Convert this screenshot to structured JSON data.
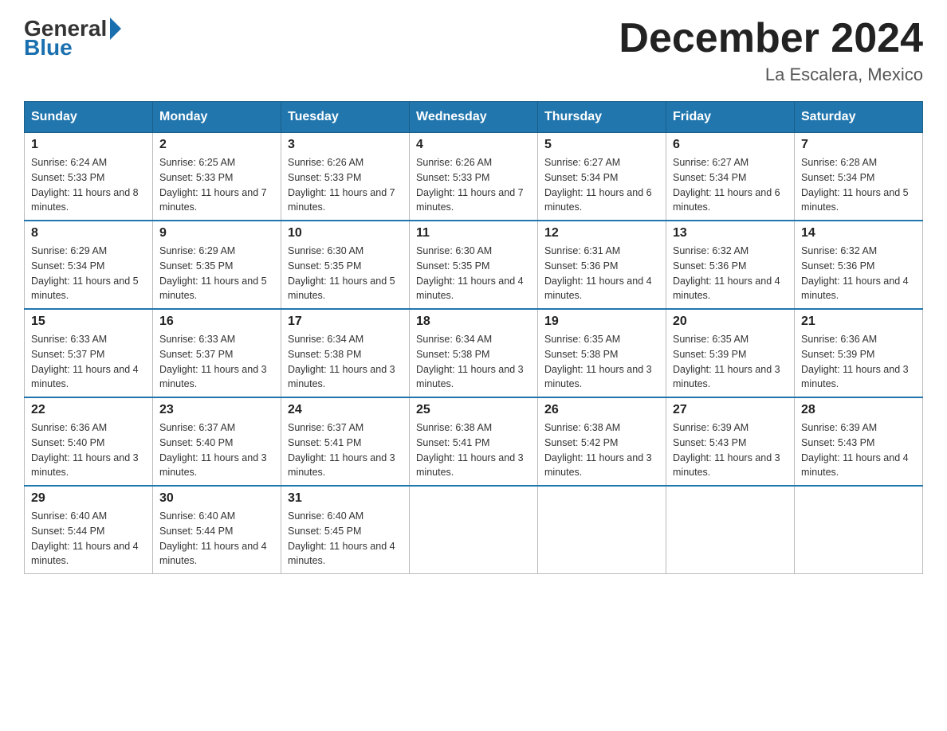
{
  "header": {
    "logo_general": "General",
    "logo_blue": "Blue",
    "month_title": "December 2024",
    "location": "La Escalera, Mexico"
  },
  "days_of_week": [
    "Sunday",
    "Monday",
    "Tuesday",
    "Wednesday",
    "Thursday",
    "Friday",
    "Saturday"
  ],
  "weeks": [
    [
      {
        "num": "1",
        "sunrise": "6:24 AM",
        "sunset": "5:33 PM",
        "daylight": "11 hours and 8 minutes."
      },
      {
        "num": "2",
        "sunrise": "6:25 AM",
        "sunset": "5:33 PM",
        "daylight": "11 hours and 7 minutes."
      },
      {
        "num": "3",
        "sunrise": "6:26 AM",
        "sunset": "5:33 PM",
        "daylight": "11 hours and 7 minutes."
      },
      {
        "num": "4",
        "sunrise": "6:26 AM",
        "sunset": "5:33 PM",
        "daylight": "11 hours and 7 minutes."
      },
      {
        "num": "5",
        "sunrise": "6:27 AM",
        "sunset": "5:34 PM",
        "daylight": "11 hours and 6 minutes."
      },
      {
        "num": "6",
        "sunrise": "6:27 AM",
        "sunset": "5:34 PM",
        "daylight": "11 hours and 6 minutes."
      },
      {
        "num": "7",
        "sunrise": "6:28 AM",
        "sunset": "5:34 PM",
        "daylight": "11 hours and 5 minutes."
      }
    ],
    [
      {
        "num": "8",
        "sunrise": "6:29 AM",
        "sunset": "5:34 PM",
        "daylight": "11 hours and 5 minutes."
      },
      {
        "num": "9",
        "sunrise": "6:29 AM",
        "sunset": "5:35 PM",
        "daylight": "11 hours and 5 minutes."
      },
      {
        "num": "10",
        "sunrise": "6:30 AM",
        "sunset": "5:35 PM",
        "daylight": "11 hours and 5 minutes."
      },
      {
        "num": "11",
        "sunrise": "6:30 AM",
        "sunset": "5:35 PM",
        "daylight": "11 hours and 4 minutes."
      },
      {
        "num": "12",
        "sunrise": "6:31 AM",
        "sunset": "5:36 PM",
        "daylight": "11 hours and 4 minutes."
      },
      {
        "num": "13",
        "sunrise": "6:32 AM",
        "sunset": "5:36 PM",
        "daylight": "11 hours and 4 minutes."
      },
      {
        "num": "14",
        "sunrise": "6:32 AM",
        "sunset": "5:36 PM",
        "daylight": "11 hours and 4 minutes."
      }
    ],
    [
      {
        "num": "15",
        "sunrise": "6:33 AM",
        "sunset": "5:37 PM",
        "daylight": "11 hours and 4 minutes."
      },
      {
        "num": "16",
        "sunrise": "6:33 AM",
        "sunset": "5:37 PM",
        "daylight": "11 hours and 3 minutes."
      },
      {
        "num": "17",
        "sunrise": "6:34 AM",
        "sunset": "5:38 PM",
        "daylight": "11 hours and 3 minutes."
      },
      {
        "num": "18",
        "sunrise": "6:34 AM",
        "sunset": "5:38 PM",
        "daylight": "11 hours and 3 minutes."
      },
      {
        "num": "19",
        "sunrise": "6:35 AM",
        "sunset": "5:38 PM",
        "daylight": "11 hours and 3 minutes."
      },
      {
        "num": "20",
        "sunrise": "6:35 AM",
        "sunset": "5:39 PM",
        "daylight": "11 hours and 3 minutes."
      },
      {
        "num": "21",
        "sunrise": "6:36 AM",
        "sunset": "5:39 PM",
        "daylight": "11 hours and 3 minutes."
      }
    ],
    [
      {
        "num": "22",
        "sunrise": "6:36 AM",
        "sunset": "5:40 PM",
        "daylight": "11 hours and 3 minutes."
      },
      {
        "num": "23",
        "sunrise": "6:37 AM",
        "sunset": "5:40 PM",
        "daylight": "11 hours and 3 minutes."
      },
      {
        "num": "24",
        "sunrise": "6:37 AM",
        "sunset": "5:41 PM",
        "daylight": "11 hours and 3 minutes."
      },
      {
        "num": "25",
        "sunrise": "6:38 AM",
        "sunset": "5:41 PM",
        "daylight": "11 hours and 3 minutes."
      },
      {
        "num": "26",
        "sunrise": "6:38 AM",
        "sunset": "5:42 PM",
        "daylight": "11 hours and 3 minutes."
      },
      {
        "num": "27",
        "sunrise": "6:39 AM",
        "sunset": "5:43 PM",
        "daylight": "11 hours and 3 minutes."
      },
      {
        "num": "28",
        "sunrise": "6:39 AM",
        "sunset": "5:43 PM",
        "daylight": "11 hours and 4 minutes."
      }
    ],
    [
      {
        "num": "29",
        "sunrise": "6:40 AM",
        "sunset": "5:44 PM",
        "daylight": "11 hours and 4 minutes."
      },
      {
        "num": "30",
        "sunrise": "6:40 AM",
        "sunset": "5:44 PM",
        "daylight": "11 hours and 4 minutes."
      },
      {
        "num": "31",
        "sunrise": "6:40 AM",
        "sunset": "5:45 PM",
        "daylight": "11 hours and 4 minutes."
      },
      null,
      null,
      null,
      null
    ]
  ],
  "labels": {
    "sunrise_prefix": "Sunrise: ",
    "sunset_prefix": "Sunset: ",
    "daylight_prefix": "Daylight: "
  }
}
